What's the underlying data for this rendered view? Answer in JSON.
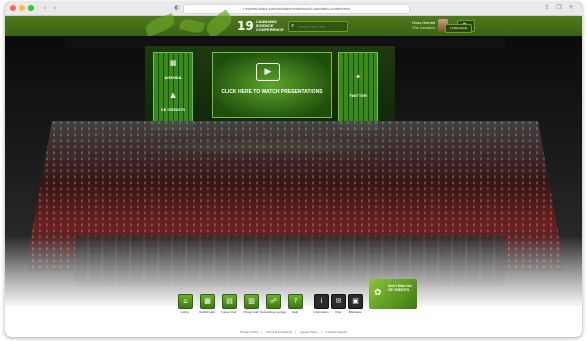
{
  "browser": {
    "back_glyph": "‹",
    "forward_glyph": "›",
    "url": "• events.vfairs.com/virtual/events/world-cannabis-conference"
  },
  "site": {
    "logo_number": "19",
    "logo_text": "CANNABIS SCIENCE CONFERENCE",
    "search_placeholder": "Search the Site",
    "user_name": "Hoss Hamlet",
    "user_location": "The Location",
    "language_label": "LANGUAGE"
  },
  "stage": {
    "left_panel": {
      "top_label": "AGENDA",
      "bottom_label": "CE CREDITS"
    },
    "screen_label": "CLICK HERE TO WATCH PRESENTATIONS",
    "right_panel": {
      "label": "TWITTER"
    }
  },
  "bottom_nav": {
    "items": [
      {
        "label": "Lobby",
        "icon": "home-icon",
        "glyph": "⌂"
      },
      {
        "label": "Exhibit Hall",
        "icon": "exhibit-icon",
        "glyph": "▦"
      },
      {
        "label": "Career Fair",
        "icon": "briefcase-icon",
        "glyph": "▤"
      },
      {
        "label": "Poster Hall",
        "icon": "poster-icon",
        "glyph": "▥"
      },
      {
        "label": "Networking Lounge",
        "icon": "network-icon",
        "glyph": "☍"
      },
      {
        "label": "Help",
        "icon": "help-icon",
        "glyph": "?"
      },
      {
        "label": "Information",
        "icon": "info-icon",
        "glyph": "i"
      },
      {
        "label": "Chat",
        "icon": "chat-icon",
        "glyph": "✉"
      },
      {
        "label": "Briefcase",
        "icon": "bag-icon",
        "glyph": "▣"
      }
    ],
    "promo_text": "Don't Miss the CE CREDITS"
  },
  "footer": {
    "links": [
      "Privacy Policy",
      "Terms & Conditions",
      "Cookie Policy",
      "Contact Support"
    ]
  },
  "colors": {
    "brand_green": "#3f6d15",
    "accent_green": "#6fc23a"
  }
}
